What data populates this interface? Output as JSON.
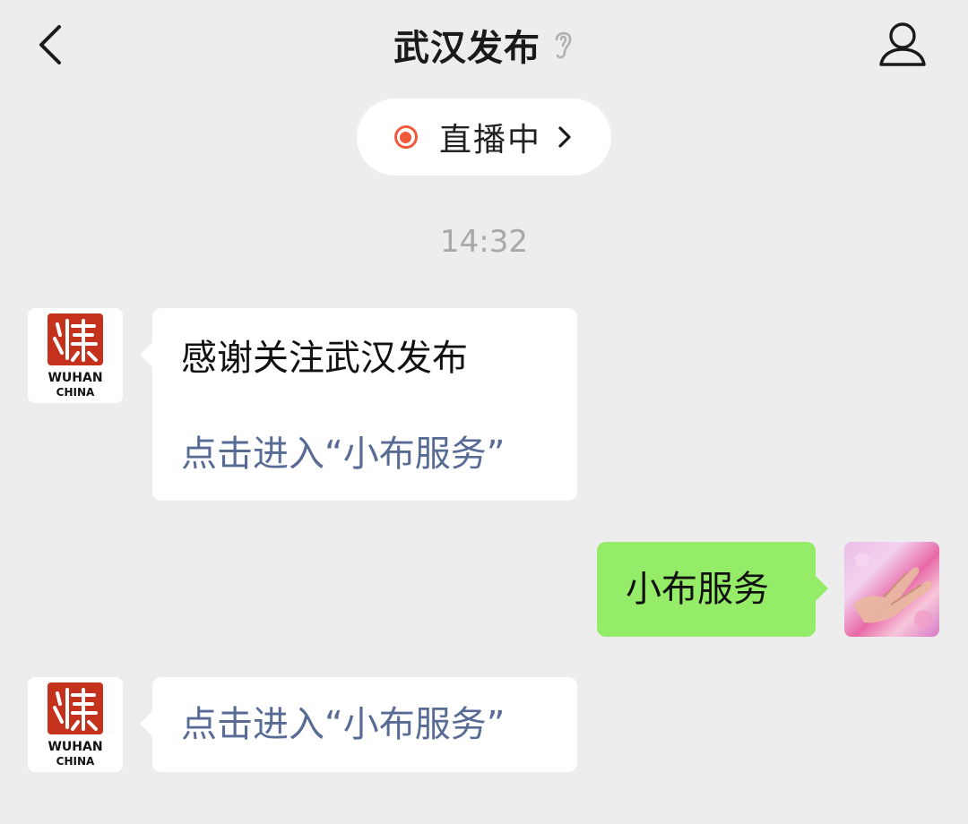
{
  "header": {
    "title": "武汉发布",
    "back_icon": "chevron-left-icon",
    "ear_icon": "ear-icon",
    "profile_icon": "person-icon"
  },
  "live": {
    "label": "直播中",
    "dot_color": "#f05a3a"
  },
  "timestamp": "14:32",
  "account_avatar": {
    "text_line1": "WUHAN",
    "text_line2": "CHINA",
    "seal_color": "#c4321e"
  },
  "messages": [
    {
      "from": "account",
      "text": "感谢关注武汉发布",
      "link": "点击进入“小布服务”"
    },
    {
      "from": "me",
      "text": "小布服务"
    },
    {
      "from": "account",
      "link": "点击进入“小布服务”"
    }
  ],
  "colors": {
    "background": "#ededed",
    "bubble_me": "#95ec69",
    "link": "#576b95"
  }
}
